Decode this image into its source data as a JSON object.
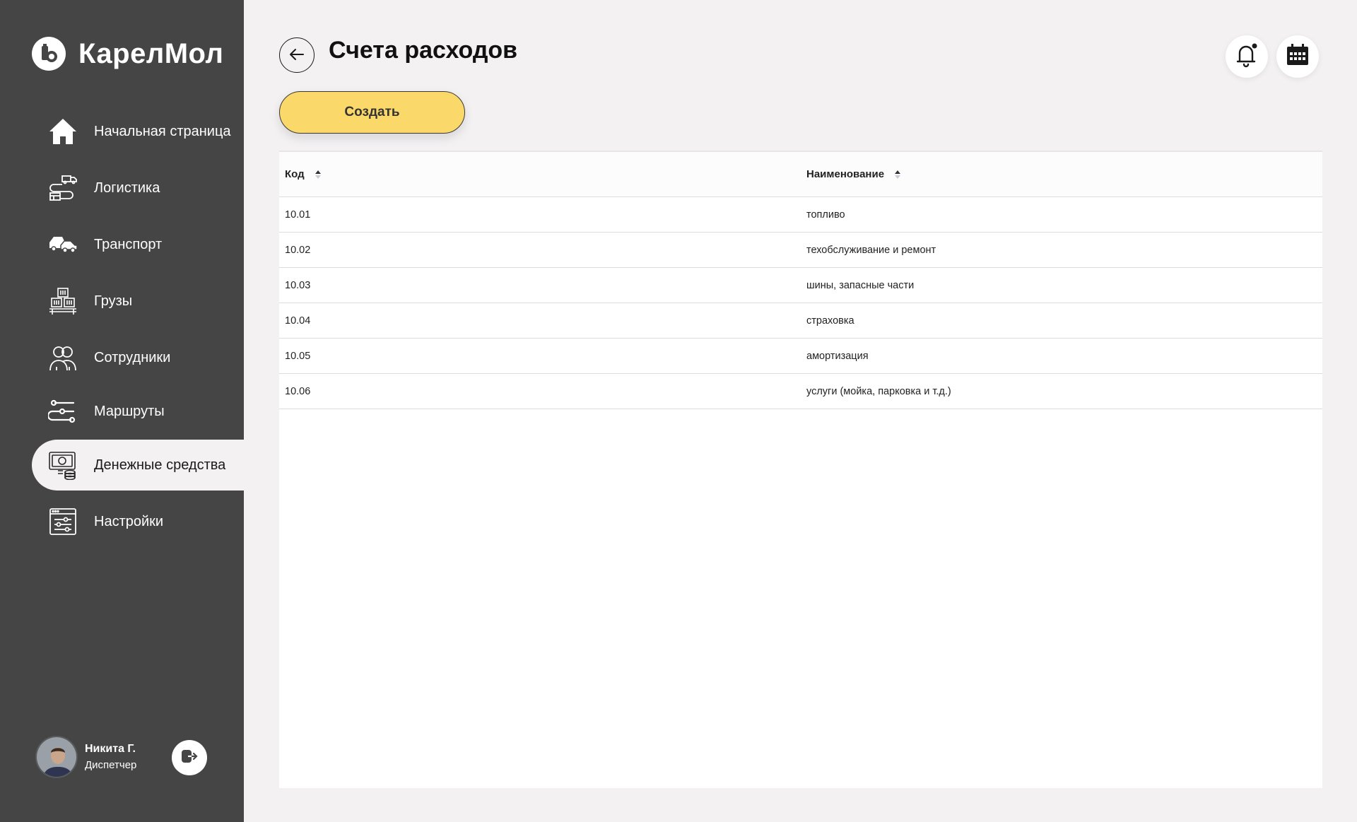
{
  "brand": {
    "name": "КарелМол"
  },
  "sidebar": {
    "items": [
      {
        "label": "Начальная страница",
        "icon": "home-icon"
      },
      {
        "label": "Логистика",
        "icon": "logistics-icon"
      },
      {
        "label": "Транспорт",
        "icon": "transport-icon"
      },
      {
        "label": "Грузы",
        "icon": "cargo-icon"
      },
      {
        "label": "Сотрудники",
        "icon": "employees-icon"
      },
      {
        "label": "Маршруты",
        "icon": "routes-icon"
      },
      {
        "label": "Денежные средства",
        "icon": "money-icon",
        "active": true
      },
      {
        "label": "Настройки",
        "icon": "settings-icon"
      }
    ]
  },
  "user": {
    "name": "Никита Г.",
    "role": "Диспетчер"
  },
  "header": {
    "title": "Счета расходов"
  },
  "toolbar": {
    "create_label": "Создать"
  },
  "table": {
    "columns": [
      "Код",
      "Наименование"
    ],
    "rows": [
      [
        "10.01",
        "топливо"
      ],
      [
        "10.02",
        "техобслуживание и ремонт"
      ],
      [
        "10.03",
        "шины, запасные части"
      ],
      [
        "10.04",
        "страховка"
      ],
      [
        "10.05",
        "амортизация"
      ],
      [
        "10.06",
        "услуги (мойка, парковка и т.д.)"
      ]
    ]
  },
  "colors": {
    "sidebar_bg": "#454545",
    "accent": "#fbd86a",
    "page_bg": "#f4f1f3"
  }
}
